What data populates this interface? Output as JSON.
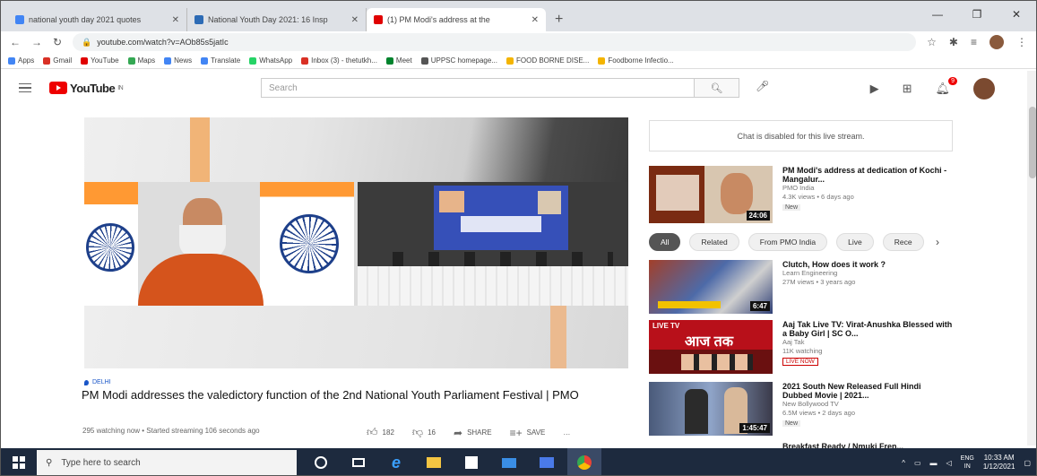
{
  "browser": {
    "tabs": [
      {
        "title": "national youth day 2021 quotes",
        "favicon_color": "#4285f4",
        "close": "✕",
        "active": false
      },
      {
        "title": "National Youth Day 2021: 16 Insp",
        "favicon_color": "#2d6bb5",
        "close": "✕",
        "active": false
      },
      {
        "title": "(1) PM Modi's address at the",
        "favicon_color": "#e00000",
        "close": "✕",
        "active": true
      }
    ],
    "new_tab": "+",
    "window_controls": [
      "—",
      "❐",
      "✕"
    ],
    "url": "youtube.com/watch?v=AOb85s5jatIc",
    "bookmarks": [
      {
        "label": "Apps",
        "color": "#4285f4"
      },
      {
        "label": "Gmail",
        "color": "#d93025"
      },
      {
        "label": "YouTube",
        "color": "#e00000"
      },
      {
        "label": "Maps",
        "color": "#34a853"
      },
      {
        "label": "News",
        "color": "#4285f4"
      },
      {
        "label": "Translate",
        "color": "#4285f4"
      },
      {
        "label": "WhatsApp",
        "color": "#25d366"
      },
      {
        "label": "Inbox (3) - thetutkh...",
        "color": "#d93025"
      },
      {
        "label": "Meet",
        "color": "#00832d"
      },
      {
        "label": "UPPSC homepage...",
        "color": "#555555"
      },
      {
        "label": "FOOD BORNE DISE...",
        "color": "#f4b400"
      },
      {
        "label": "Foodborne Infectio...",
        "color": "#f4b400"
      }
    ]
  },
  "youtube": {
    "logo_text": "YouTube",
    "logo_sup": "IN",
    "search_placeholder": "Search",
    "notification_count": "9"
  },
  "video": {
    "location": "DELHI",
    "title": "PM Modi addresses the valedictory function of the 2nd National Youth Parliament Festival | PMO",
    "meta": "295 watching now • Started streaming 106 seconds ago",
    "likes": "182",
    "dislikes": "16",
    "share": "SHARE",
    "save": "SAVE",
    "more": "…"
  },
  "chat_disabled": "Chat is disabled for this live stream.",
  "first_rec": {
    "title": "PM Modi's address at dedication of Kochi - Mangalur...",
    "channel": "PMO India",
    "stats": "4.3K views • 6 days ago",
    "badge": "New",
    "duration": "24:06"
  },
  "chips": [
    "All",
    "Related",
    "From PMO India",
    "Live",
    "Rece"
  ],
  "recommendations": [
    {
      "title": "Clutch, How does it work ?",
      "channel": "Learn Engineering",
      "stats": "27M views • 3 years ago",
      "badge": "",
      "duration": "6:47",
      "live": false
    },
    {
      "title": "Aaj Tak Live TV: Virat-Anushka Blessed with a Baby Girl | SC O...",
      "channel": "Aaj Tak",
      "stats": "11K watching",
      "badge": "LIVE NOW",
      "duration": "",
      "live": true
    },
    {
      "title": "2021 South New Released Full Hindi Dubbed Movie | 2021...",
      "channel": "New Bollywood TV",
      "stats": "6.5M views • 2 days ago",
      "badge": "New",
      "duration": "1:45:47",
      "live": false
    },
    {
      "title": "Breakfast Ready / Nmuki Fren...",
      "channel": "",
      "stats": "",
      "badge": "",
      "duration": "",
      "live": false
    }
  ],
  "taskbar": {
    "search_placeholder": "Type here to search",
    "lang_top": "ENG",
    "lang_bottom": "IN",
    "time": "10:33 AM",
    "date": "1/12/2021"
  }
}
